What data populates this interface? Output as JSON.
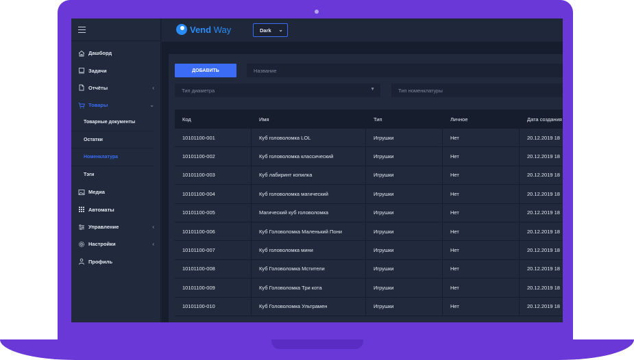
{
  "app": {
    "logo_bold": "Vend",
    "logo_light": " Way",
    "theme": "Dark"
  },
  "sidebar": {
    "items": [
      {
        "label": "Дашборд",
        "icon": "home-icon"
      },
      {
        "label": "Задачи",
        "icon": "tasks-icon"
      },
      {
        "label": "Отчёты",
        "icon": "file-icon",
        "has_submenu": true
      },
      {
        "label": "Товары",
        "icon": "cart-icon",
        "has_submenu": true,
        "expanded": true
      }
    ],
    "subitems": [
      {
        "label": "Товарные документы"
      },
      {
        "label": "Остатки"
      },
      {
        "label": "Номенклатура",
        "active": true
      },
      {
        "label": "Тэги"
      }
    ],
    "items_after": [
      {
        "label": "Медиа",
        "icon": "image-icon"
      },
      {
        "label": "Автоматы",
        "icon": "grid-icon"
      },
      {
        "label": "Управление",
        "icon": "sliders-icon",
        "has_submenu": true
      },
      {
        "label": "Настройки",
        "icon": "gear-icon",
        "has_submenu": true
      },
      {
        "label": "Профиль",
        "icon": "user-icon"
      }
    ]
  },
  "toolbar": {
    "add_label": "ДОБАВИТЬ",
    "name_placeholder": "Название",
    "diameter_placeholder": "Тип диаметра",
    "nomenclature_placeholder": "Тип номенклатуры"
  },
  "table": {
    "headers": [
      "Код",
      "Имя",
      "Тип",
      "Личное",
      "Дата создания"
    ],
    "rows": [
      [
        "10101100-001",
        "Куб головоломка LOL",
        "Игрушки",
        "Нет",
        "20.12.2019 18"
      ],
      [
        "10101100-002",
        "Куб головоломка классический",
        "Игрушки",
        "Нет",
        "20.12.2019 18"
      ],
      [
        "10101100-003",
        "Куб лабиринт копилка",
        "Игрушки",
        "Нет",
        "20.12.2019 18"
      ],
      [
        "10101100-004",
        "Куб головоломка магический",
        "Игрушки",
        "Нет",
        "20.12.2019 18"
      ],
      [
        "10101100-005",
        "Магический куб головоломка",
        "Игрушки",
        "Нет",
        "20.12.2019 18"
      ],
      [
        "10101100-006",
        "Куб Головоломка Маленький Пони",
        "Игрушки",
        "Нет",
        "20.12.2019 18"
      ],
      [
        "10101100-007",
        "Куб головоломка мини",
        "Игрушки",
        "Нет",
        "20.12.2019 18"
      ],
      [
        "10101100-008",
        "Куб Головоломка Мстители",
        "Игрушки",
        "Нет",
        "20.12.2019 18"
      ],
      [
        "10101100-009",
        "Куб Головоломка Три кота",
        "Игрушки",
        "Нет",
        "20.12.2019 18"
      ],
      [
        "10101100-010",
        "Куб Головоломка Ультрамен",
        "Игрушки",
        "Нет",
        "20.12.2019 18"
      ]
    ]
  },
  "colors": {
    "frame": "#6a38d6",
    "accent": "#3b6cf6",
    "logo": "#2a8cf7",
    "background": "#1a2233"
  }
}
